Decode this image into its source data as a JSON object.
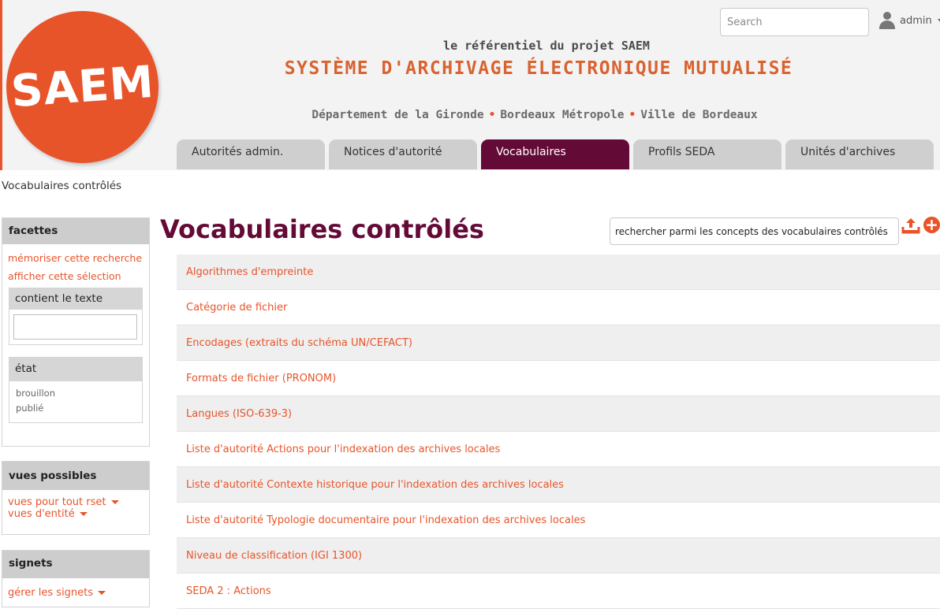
{
  "header": {
    "logo_text": "SAEM",
    "tagline": "le référentiel du projet SAEM",
    "system_title": "SYSTÈME D'ARCHIVAGE ÉLECTRONIQUE MUTUALISÉ",
    "partners": [
      "Département de la Gironde",
      "Bordeaux Métropole",
      "Ville de Bordeaux"
    ],
    "search_placeholder": "Search",
    "user_label": "admin"
  },
  "nav_tabs": [
    {
      "label": "Autorités admin.",
      "active": false
    },
    {
      "label": "Notices d'autorité",
      "active": false
    },
    {
      "label": "Vocabulaires",
      "active": true
    },
    {
      "label": "Profils SEDA",
      "active": false
    },
    {
      "label": "Unités d'archives",
      "active": false
    }
  ],
  "breadcrumb": "Vocabulaires contrôlés",
  "sidebar": {
    "facets": {
      "title": "facettes",
      "save_search": "mémoriser cette recherche",
      "show_selection": "afficher cette sélection",
      "text_filter_title": "contient le texte",
      "state_title": "état",
      "states": [
        "brouillon",
        "publié"
      ]
    },
    "views": {
      "title": "vues possibles",
      "items": [
        "vues pour tout rset",
        "vues d'entité"
      ]
    },
    "bookmarks": {
      "title": "signets",
      "manage": "gérer les signets"
    }
  },
  "main": {
    "title": "Vocabulaires contrôlés",
    "concept_search_placeholder": "rechercher parmi les concepts des vocabulaires contrôlés",
    "vocabularies": [
      "Algorithmes d'empreinte",
      "Catégorie de fichier",
      "Encodages (extraits du schéma UN/CEFACT)",
      "Formats de fichier (PRONOM)",
      "Langues (ISO-639-3)",
      "Liste d'autorité Actions pour l'indexation des archives locales",
      "Liste d'autorité Contexte historique pour l'indexation des archives locales",
      "Liste d'autorité Typologie documentaire pour l'indexation des archives locales",
      "Niveau de classification (IGI 1300)",
      "SEDA 2 : Actions"
    ]
  },
  "colors": {
    "accent": "#e8542a",
    "brand_dark": "#640a37",
    "tab_inactive": "#cfcfcf",
    "panel_header": "#cdcdcd"
  },
  "icons": [
    "user-icon",
    "caret-down-icon",
    "upload-icon",
    "add-icon"
  ]
}
